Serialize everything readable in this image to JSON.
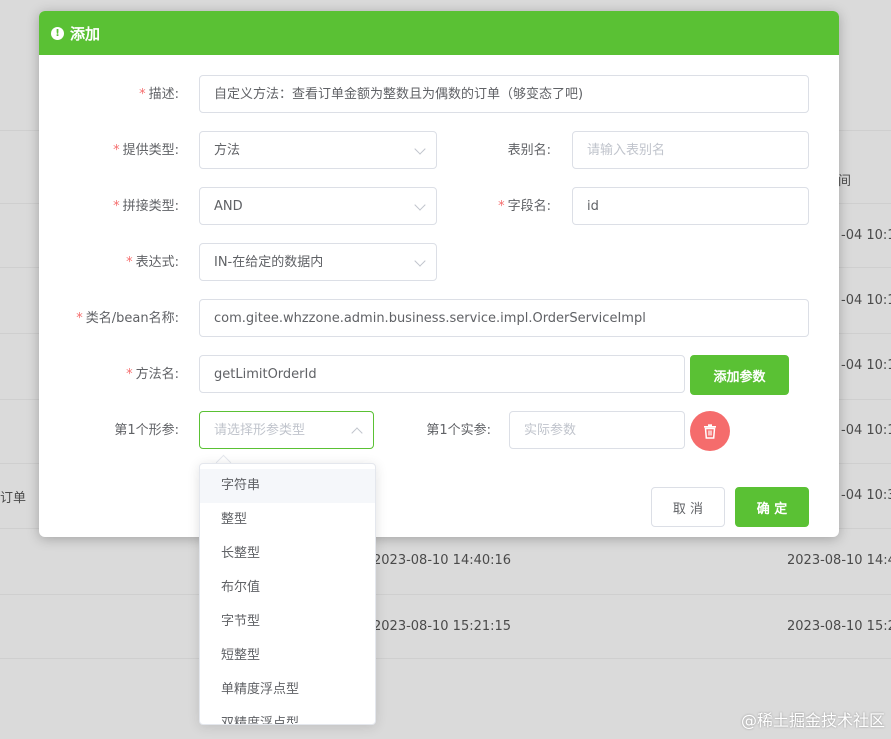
{
  "dialog": {
    "title": "添加",
    "form": {
      "description": {
        "label": "描述:",
        "value": "自定义方法：查看订单金额为整数且为偶数的订单（够变态了吧)"
      },
      "provide_type": {
        "label": "提供类型:",
        "value": "方法"
      },
      "table_alias": {
        "label": "表别名:",
        "placeholder": "请输入表别名"
      },
      "join_type": {
        "label": "拼接类型:",
        "value": "AND"
      },
      "field_name": {
        "label": "字段名:",
        "value": "id"
      },
      "expression": {
        "label": "表达式:",
        "value": "IN-在给定的数据内"
      },
      "class_name": {
        "label": "类名/bean名称:",
        "value": "com.gitee.whzzone.admin.business.service.impl.OrderServiceImpl"
      },
      "method_name": {
        "label": "方法名:",
        "value": "getLimitOrderId"
      },
      "add_param_button": "添加参数",
      "param1_formal": {
        "label": "第1个形参:",
        "placeholder": "请选择形参类型"
      },
      "param1_actual": {
        "label": "第1个实参:",
        "placeholder": "实际参数"
      }
    },
    "cancel_button": "取 消",
    "confirm_button": "确 定"
  },
  "dropdown_options": [
    "字符串",
    "整型",
    "长整型",
    "布尔值",
    "字节型",
    "短整型",
    "单精度浮点型",
    "双精度浮点型"
  ],
  "background": {
    "header_cell": "间",
    "date_partials": [
      "-04 10:1",
      "-04 10:1",
      "-04 10:1",
      "-04 10:1",
      "-04 10:3"
    ],
    "row_label": "订单",
    "rows": [
      {
        "created": "2023-08-10 14:40:16",
        "updated": "2023-08-10 14:4"
      },
      {
        "created": "2023-08-10 15:21:15",
        "updated": "2023-08-10 15:2"
      }
    ]
  },
  "watermark": "@稀土掘金技术社区",
  "colors": {
    "primary": "#5ac134",
    "danger": "#f56c6c",
    "required": "#f56c6c"
  }
}
